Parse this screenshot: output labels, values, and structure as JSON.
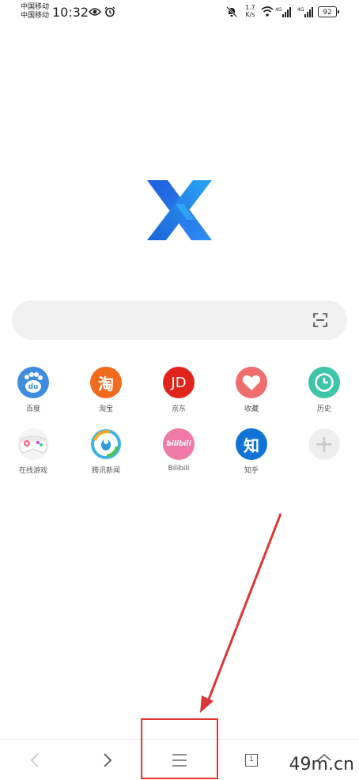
{
  "status_bar": {
    "carrier_1": "中国移动",
    "carrier_2": "中国移动",
    "time": "10:32",
    "net_speed_value": "1.7",
    "net_speed_unit": "K/s",
    "sig1_label": "4G",
    "sig2_label": "4G",
    "battery": "92"
  },
  "search": {
    "placeholder": ""
  },
  "shortcuts": [
    {
      "label": "百度",
      "icon": "baidu-icon",
      "color": "#3d8ce0",
      "glyph": "du"
    },
    {
      "label": "淘宝",
      "icon": "taobao-icon",
      "color": "#f26a1b",
      "glyph": "淘"
    },
    {
      "label": "京东",
      "icon": "jd-icon",
      "color": "#e0241c",
      "glyph": "JD"
    },
    {
      "label": "收藏",
      "icon": "heart-icon",
      "color": "#f06d6d",
      "glyph": ""
    },
    {
      "label": "历史",
      "icon": "clock-icon",
      "color": "#3ec5a7",
      "glyph": ""
    },
    {
      "label": "在线游戏",
      "icon": "gamepad-icon",
      "color": "#f4f4f4",
      "glyph": ""
    },
    {
      "label": "腾讯新闻",
      "icon": "tencent-news-icon",
      "color": "#ffffff",
      "glyph": ""
    },
    {
      "label": "Bilibili",
      "icon": "bilibili-icon",
      "color": "#f07aa6",
      "glyph": "bilibili"
    },
    {
      "label": "知乎",
      "icon": "zhihu-icon",
      "color": "#1273d6",
      "glyph": "知"
    },
    {
      "label": "",
      "icon": "add-icon",
      "color": "#eeeeee",
      "glyph": "+"
    }
  ],
  "bottom_nav": {
    "tab_count": "1"
  },
  "watermark": "49m.cn"
}
